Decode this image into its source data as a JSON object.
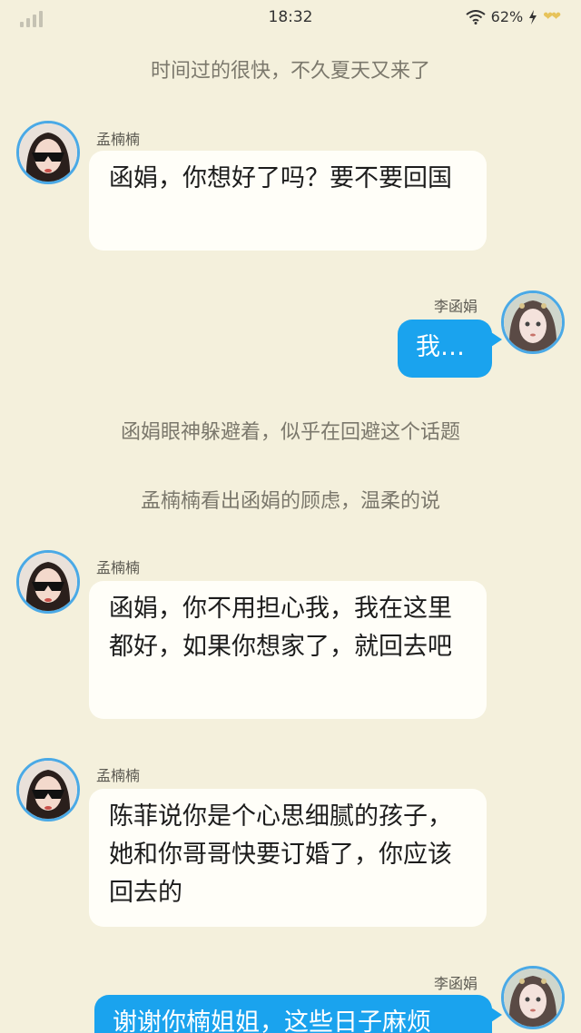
{
  "status": {
    "time": "18:32",
    "battery": "62%",
    "hearts": "❤❤"
  },
  "narrations": [
    "时间过的很快，不久夏天又来了",
    "函娟眼神躲避着，似乎在回避这个话题",
    "孟楠楠看出函娟的顾虑，温柔的说"
  ],
  "messages": [
    {
      "sender": "孟楠楠",
      "text": "函娟，你想好了吗？要不要回国"
    },
    {
      "sender": "李函娟",
      "text": "我…"
    },
    {
      "sender": "孟楠楠",
      "text": "函娟，你不用担心我，我在这里都好，如果你想家了，就回去吧"
    },
    {
      "sender": "孟楠楠",
      "text": "陈菲说你是个心思细腻的孩子，她和你哥哥快要订婚了，你应该回去的"
    },
    {
      "sender": "李函娟",
      "text": "谢谢你楠姐姐，这些日子麻烦"
    }
  ],
  "colors": {
    "background": "#f4f0dc",
    "bubble_other": "#fffef8",
    "bubble_self": "#1aa3ee",
    "avatar_border": "#4aa9e6"
  },
  "icons": [
    "signal-icon",
    "wifi-icon",
    "charging-icon",
    "heart-icon"
  ]
}
